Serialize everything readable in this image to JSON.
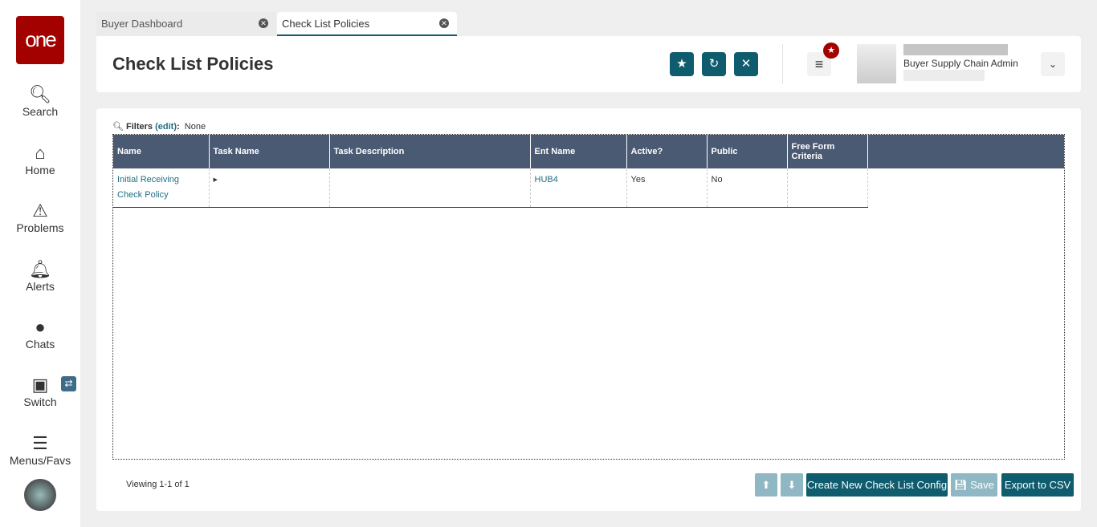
{
  "sidebar": {
    "logo": "one",
    "items": [
      {
        "label": "Search",
        "icon": "search-icon"
      },
      {
        "label": "Home",
        "icon": "home-icon"
      },
      {
        "label": "Problems",
        "icon": "warning-icon"
      },
      {
        "label": "Alerts",
        "icon": "bell-icon"
      },
      {
        "label": "Chats",
        "icon": "chat-icon"
      },
      {
        "label": "Switch",
        "icon": "switch-icon"
      },
      {
        "label": "Menus/Favs",
        "icon": "menu-icon"
      }
    ]
  },
  "tabs": [
    {
      "label": "Buyer Dashboard"
    },
    {
      "label": "Check List Policies"
    }
  ],
  "header": {
    "title": "Check List Policies",
    "user_role": "Buyer Supply Chain Admin"
  },
  "filters": {
    "label": "Filters",
    "edit": "(edit)",
    "colon": ":",
    "value": "None"
  },
  "table": {
    "columns": [
      "Name",
      "Task Name",
      "Task Description",
      "Ent Name",
      "Active?",
      "Public",
      "Free Form Criteria"
    ],
    "rows": [
      [
        "Initial Receiving Check Policy",
        "",
        "",
        "HUB4",
        "Yes",
        "No",
        ""
      ]
    ]
  },
  "footer": {
    "viewing": "Viewing 1-1 of 1",
    "create": "Create New Check List Config",
    "save": "Save",
    "export": "Export to CSV"
  },
  "colors": {
    "accent": "#0f5c6e",
    "header": "#4a5a73",
    "brand": "#a30000"
  }
}
